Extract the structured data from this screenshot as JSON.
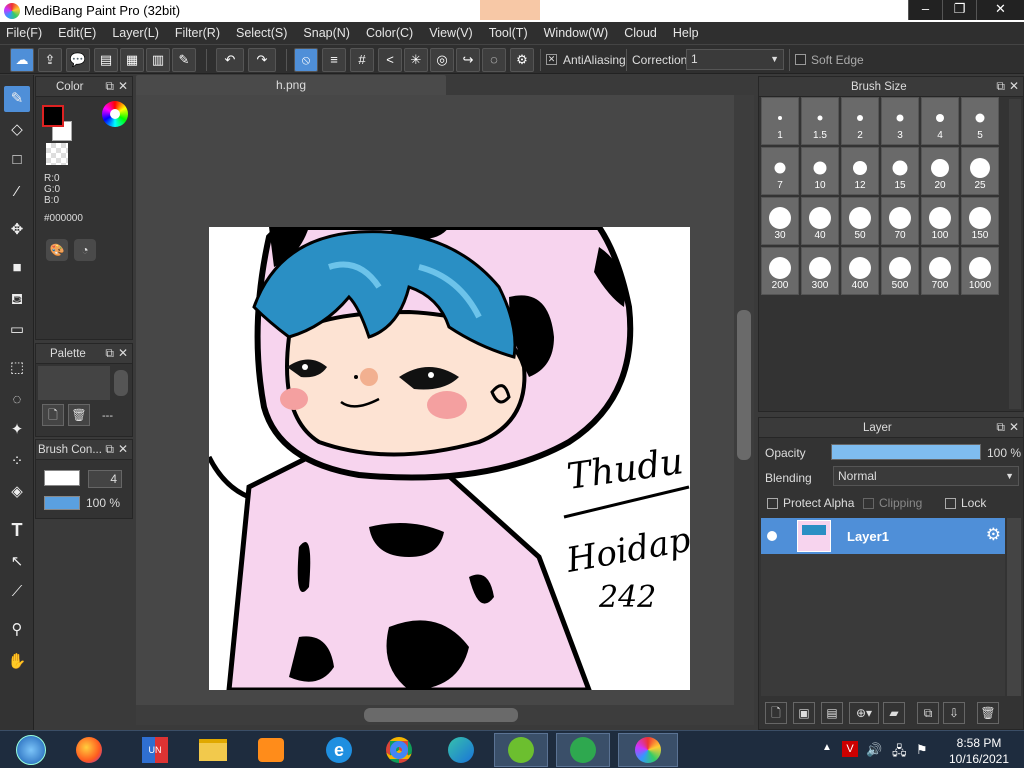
{
  "window": {
    "title": "MediBang Paint Pro (32bit)",
    "controls": [
      "–",
      "❐",
      "✕"
    ]
  },
  "menu": [
    "File(F)",
    "Edit(E)",
    "Layer(L)",
    "Filter(R)",
    "Select(S)",
    "Snap(N)",
    "Color(C)",
    "View(V)",
    "Tool(T)",
    "Window(W)",
    "Cloud",
    "Help"
  ],
  "toolbar": {
    "antialiasing_label": "AntiAliasing",
    "antialiasing_checked": true,
    "correction_label": "Correction",
    "correction_value": "1",
    "soft_edge_label": "Soft Edge",
    "soft_edge_checked": false
  },
  "color_panel": {
    "title": "Color",
    "r": "R:0",
    "g": "G:0",
    "b": "B:0",
    "hex": "#000000",
    "foreground": "#000000",
    "background": "#ffffff"
  },
  "palette_panel": {
    "title": "Palette",
    "dash": "---"
  },
  "brush_control_panel": {
    "title": "Brush Con...",
    "size": "4",
    "opacity": "100 %"
  },
  "document": {
    "tab": "h.png"
  },
  "artwork": {
    "signature_line1": "Thudu",
    "signature_line2": "Hoidap",
    "signature_line3": "242"
  },
  "brush_size_panel": {
    "title": "Brush Size",
    "sizes": [
      "1",
      "1.5",
      "2",
      "3",
      "4",
      "5",
      "7",
      "10",
      "12",
      "15",
      "20",
      "25",
      "30",
      "40",
      "50",
      "70",
      "100",
      "150",
      "200",
      "300",
      "400",
      "500",
      "700",
      "1000"
    ]
  },
  "layer_panel": {
    "title": "Layer",
    "opacity_label": "Opacity",
    "opacity_value": "100 %",
    "opacity_fraction": 1.0,
    "blending_label": "Blending",
    "blending_value": "Normal",
    "protect_alpha_label": "Protect Alpha",
    "clipping_label": "Clipping",
    "lock_label": "Lock",
    "layers": [
      {
        "name": "Layer1",
        "visible": true,
        "selected": true
      }
    ]
  },
  "taskbar": {
    "time": "8:58 PM",
    "date": "10/16/2021"
  },
  "colors": {
    "accent": "#4f8fd8",
    "hair": "#2a8fc4",
    "hoodie": "#f7d4ee",
    "skin": "#fde3d3",
    "blush": "#f4a0a0"
  }
}
